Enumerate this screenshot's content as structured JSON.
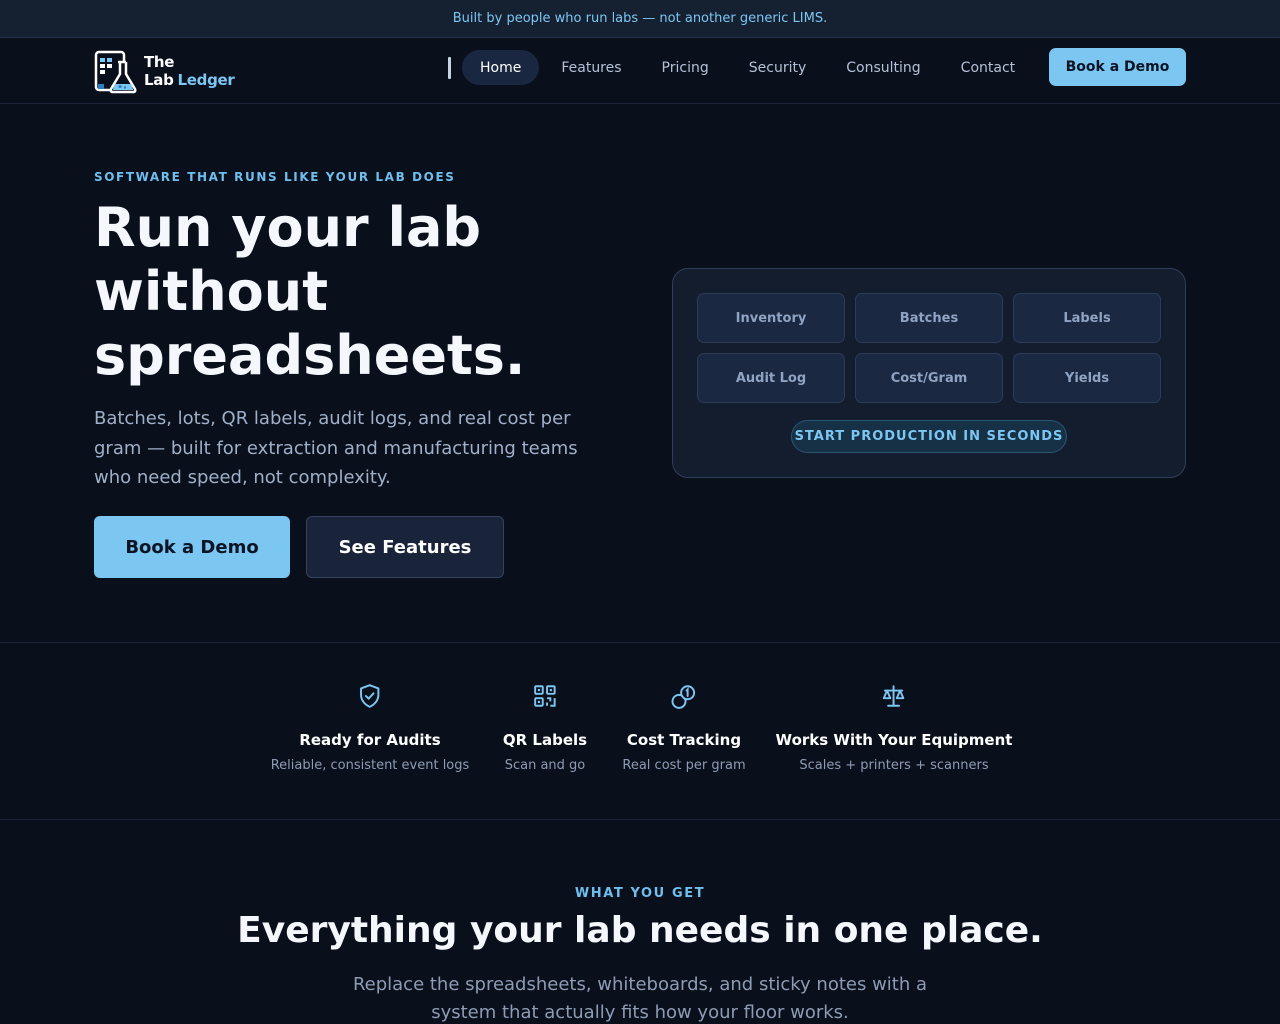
{
  "announcement": "Built by people who run labs — not another generic LIMS.",
  "logo": {
    "line1": "The",
    "line2a": "Lab",
    "line2b": "Ledger"
  },
  "nav": {
    "items": [
      "Home",
      "Features",
      "Pricing",
      "Security",
      "Consulting",
      "Contact"
    ],
    "active": "Home",
    "cta": "Book a Demo"
  },
  "hero": {
    "eyebrow": "SOFTWARE THAT RUNS LIKE YOUR LAB DOES",
    "title": "Run your lab without spreadsheets.",
    "subtitle": "Batches, lots, QR labels, audit logs, and real cost per gram — built for extraction and manufacturing teams who need speed, not complexity.",
    "primary_button": "Book a Demo",
    "secondary_button": "See Features"
  },
  "panel": {
    "tiles": [
      "Inventory",
      "Batches",
      "Labels",
      "Audit Log",
      "Cost/Gram",
      "Yields"
    ],
    "pill": "START PRODUCTION IN SECONDS"
  },
  "features": [
    {
      "icon": "shield-check-icon",
      "title": "Ready for Audits",
      "desc": "Reliable, consistent event logs"
    },
    {
      "icon": "qr-code-icon",
      "title": "QR Labels",
      "desc": "Scan and go"
    },
    {
      "icon": "coins-icon",
      "title": "Cost Tracking",
      "desc": "Real cost per gram"
    },
    {
      "icon": "scale-icon",
      "title": "Works With Your Equipment",
      "desc": "Scales + printers + scanners"
    }
  ],
  "section": {
    "eyebrow": "WHAT YOU GET",
    "title": "Everything your lab needs in one place.",
    "subtitle": "Replace the spreadsheets, whiteboards, and sticky notes with a system that actually fits how your floor works."
  },
  "colors": {
    "accent": "#7cc6f2",
    "background": "#0a0f1c",
    "panel": "#141d2e"
  }
}
